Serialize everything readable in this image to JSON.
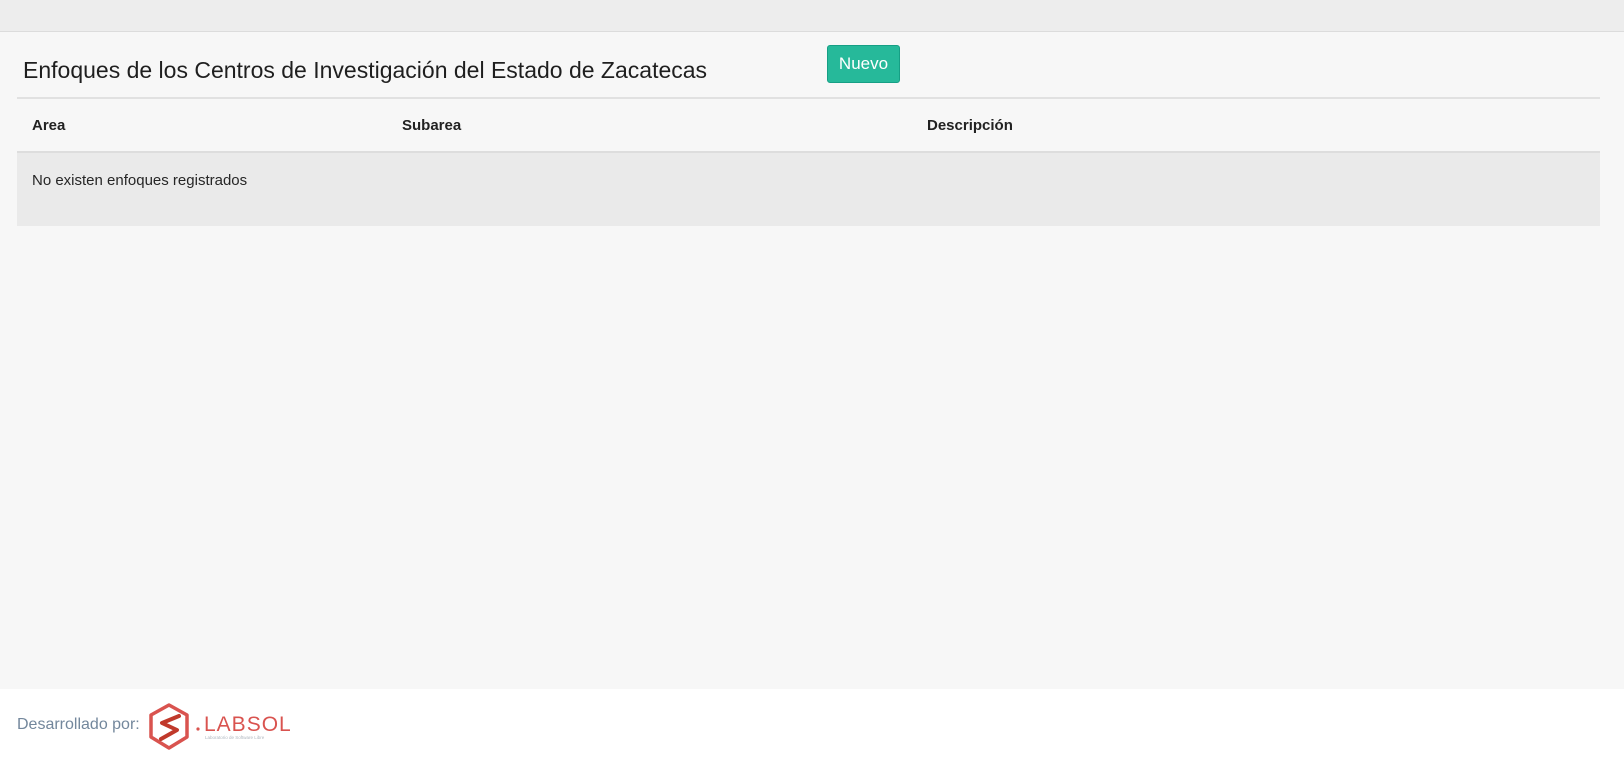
{
  "header": {
    "title": "Enfoques de los Centros de Investigación del Estado de Zacatecas",
    "new_button_label": "Nuevo"
  },
  "table": {
    "columns": [
      "Area",
      "Subarea",
      "Descripción"
    ],
    "empty_message": "No existen enfoques registrados"
  },
  "footer": {
    "label": "Desarrollado por:",
    "logo_text": "LABSOL",
    "logo_subtext": "Laboratorio de Software Libre"
  },
  "colors": {
    "accent": "#26b99a",
    "logo": "#d9534f",
    "footer_text": "#73879c"
  },
  "icons": {
    "logo": "labsol-logo"
  }
}
